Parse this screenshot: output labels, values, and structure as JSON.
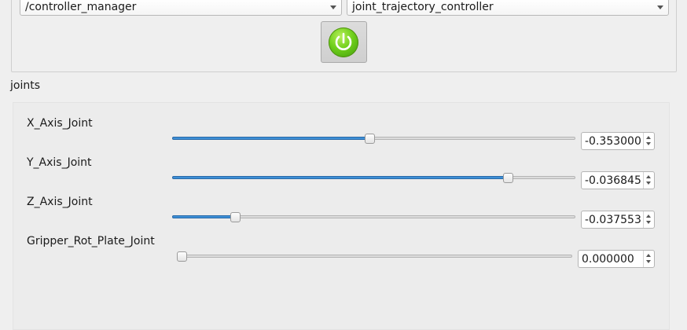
{
  "controller": {
    "manager_value": "/controller_manager",
    "controller_value": "joint_trajectory_controller",
    "power_icon": "power-icon",
    "power_colors": {
      "fill": "#6fcf1b",
      "glyph": "#ffffff"
    }
  },
  "joints_section": {
    "label": "joints",
    "items": [
      {
        "name": "X_Axis_Joint",
        "value": "-0.353000",
        "slider_fraction": 0.49
      },
      {
        "name": "Y_Axis_Joint",
        "value": "-0.036845",
        "slider_fraction": 0.841
      },
      {
        "name": "Z_Axis_Joint",
        "value": "-0.037553",
        "slider_fraction": 0.148
      },
      {
        "name": "Gripper_Rot_Plate_Joint",
        "value": "0.000000",
        "slider_fraction": 0.0
      }
    ]
  },
  "colors": {
    "slider_fill": "#3d8fd6",
    "background": "#efefef"
  }
}
